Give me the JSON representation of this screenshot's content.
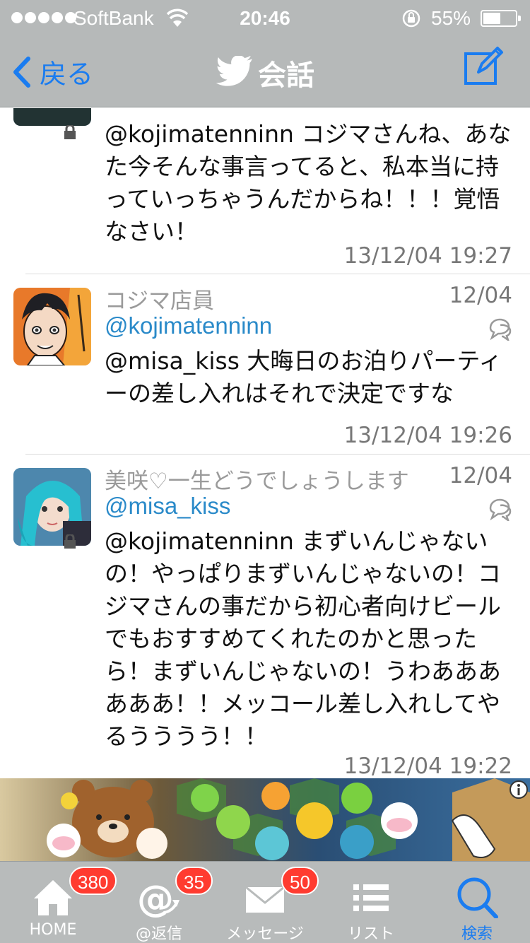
{
  "status_bar": {
    "carrier": "SoftBank",
    "time": "20:46",
    "battery": "55%",
    "battery_level": 0.55
  },
  "nav": {
    "back_label": "戻る",
    "title": "会話",
    "compose_icon": "compose-icon"
  },
  "tweets": [
    {
      "body": "@kojimatenninn コジマさんね、あなた今そんな事言ってると、私本当に持っていっちゃうんだからね！！！覚悟なさい！",
      "timestamp": "13/12/04 19:27"
    },
    {
      "name": "コジマ店員",
      "handle": "@kojimatenninn",
      "date": "12/04",
      "body": "@misa_kiss 大晦日のお泊りパーティーの差し入れはそれで決定ですな",
      "timestamp": "13/12/04 19:26"
    },
    {
      "name": "美咲♡一生どうでしょうします",
      "handle": "@misa_kiss",
      "date": "12/04",
      "body": "@kojimatenninn まずいんじゃないの！やっぱりまずいんじゃないの！コジマさんの事だから初心者向けビールでもおすすめてくれたのかと思ったら！まずいんじゃないの！うわああああああ！！メッコール差し入れしてやるうううう！！",
      "timestamp": "13/12/04 19:22"
    }
  ],
  "ad": {
    "info_icon": "info-icon"
  },
  "tabbar": {
    "tabs": [
      {
        "label": "HOME",
        "badge": "380",
        "icon": "home-icon"
      },
      {
        "label": "@返信",
        "badge": "35",
        "icon": "at-reply-icon"
      },
      {
        "label": "メッセージ",
        "badge": "50",
        "icon": "envelope-icon"
      },
      {
        "label": "リスト",
        "badge": "",
        "icon": "list-icon"
      },
      {
        "label": "検索",
        "badge": "",
        "icon": "search-icon"
      }
    ]
  },
  "colors": {
    "accent": "#1a7cf0",
    "chrome": "#b6b9b9",
    "handle": "#2a8ac9",
    "badge": "#ff3b30"
  }
}
